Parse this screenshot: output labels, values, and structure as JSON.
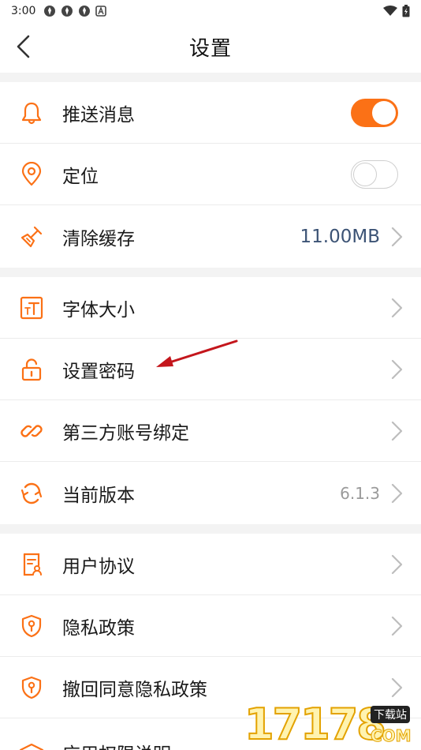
{
  "colors": {
    "accent": "#fb7116",
    "value_blue": "#3c5375",
    "value_gray": "#9a9a9a"
  },
  "status_bar": {
    "time": "3:00",
    "icons": [
      "notification-icon",
      "notification-icon",
      "notification-icon",
      "a-icon"
    ],
    "right_icons": [
      "wifi-icon",
      "battery-icon"
    ]
  },
  "header": {
    "title": "设置",
    "back_icon": "chevron-left-icon"
  },
  "groups": [
    {
      "items": [
        {
          "label": "推送消息",
          "icon": "bell-icon",
          "control": "toggle",
          "toggle_on": true
        },
        {
          "label": "定位",
          "icon": "location-pin-icon",
          "control": "toggle",
          "toggle_on": false
        },
        {
          "label": "清除缓存",
          "icon": "broom-icon",
          "control": "value",
          "value": "11.00MB"
        }
      ]
    },
    {
      "items": [
        {
          "label": "字体大小",
          "icon": "font-size-icon",
          "control": "chevron"
        },
        {
          "label": "设置密码",
          "icon": "lock-icon",
          "control": "chevron"
        },
        {
          "label": "第三方账号绑定",
          "icon": "link-icon",
          "control": "chevron"
        },
        {
          "label": "当前版本",
          "icon": "refresh-icon",
          "control": "value",
          "value": "6.1.3"
        }
      ]
    },
    {
      "items": [
        {
          "label": "用户协议",
          "icon": "document-user-icon",
          "control": "chevron"
        },
        {
          "label": "隐私政策",
          "icon": "shield-lock-icon",
          "control": "chevron"
        },
        {
          "label": "撤回同意隐私政策",
          "icon": "shield-lock-icon",
          "control": "chevron"
        },
        {
          "label": "应用权限说明",
          "icon": "graduation-cap-icon",
          "control": "chevron"
        }
      ]
    }
  ],
  "watermark": {
    "text": "17178",
    "badge": "下载站",
    "suffix": "COM"
  }
}
